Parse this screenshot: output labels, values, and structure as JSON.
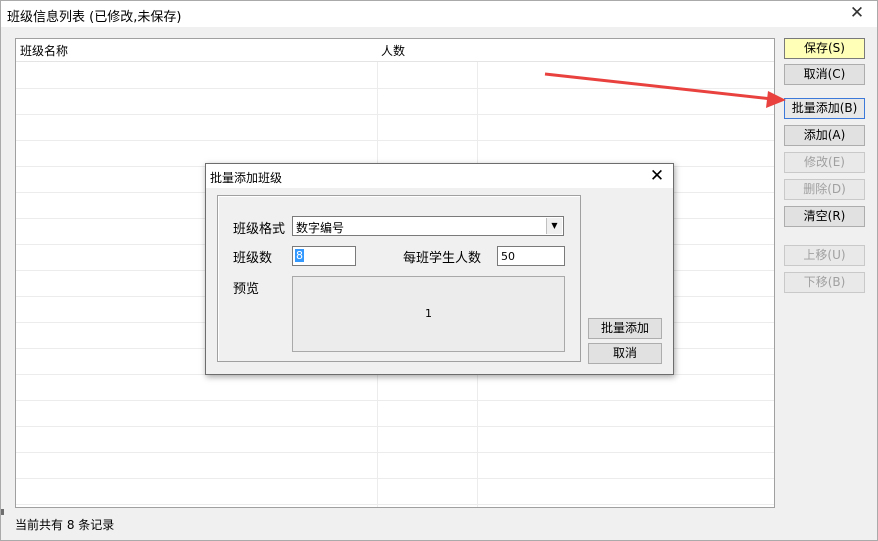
{
  "window": {
    "title": "班级信息列表 (已修改,未保存)",
    "close_glyph": "✕"
  },
  "grid": {
    "columns": [
      "班级名称",
      "人数"
    ],
    "rows": []
  },
  "side_buttons": {
    "save": "保存(S)",
    "cancel": "取消(C)",
    "batch_add": "批量添加(B)",
    "add": "添加(A)",
    "edit": "修改(E)",
    "delete": "删除(D)",
    "clear": "清空(R)",
    "move_up": "上移(U)",
    "move_down": "下移(B)"
  },
  "status_bar": {
    "text": "当前共有 8 条记录"
  },
  "dialog": {
    "title": "批量添加班级",
    "close_glyph": "✕",
    "format_label": "班级格式",
    "format_value": "数字编号",
    "count_label": "班级数",
    "count_value": "8",
    "students_label": "每班学生人数",
    "students_value": "50",
    "preview_label": "预览",
    "preview_text": "1",
    "batch_add_button": "批量添加",
    "cancel_button": "取消"
  },
  "colors": {
    "arrow": "#e8413e",
    "default_button": "#ffffb8",
    "selection": "#3399ff"
  },
  "icons": {
    "combo_arrow": "chevron-down-icon",
    "close": "close-icon"
  }
}
